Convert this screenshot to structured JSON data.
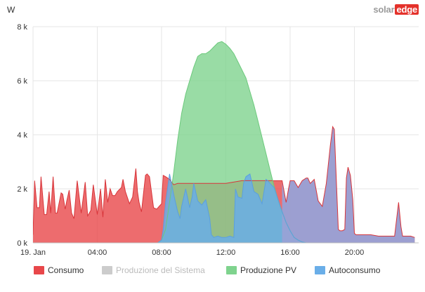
{
  "header": {
    "unit_label": "W",
    "brand_part1": "solar",
    "brand_part2": "edge"
  },
  "colors": {
    "consumo": "#e8474a",
    "produzione_sistema": "#cccccc",
    "produzione_pv": "#7fd38e",
    "autoconsumo": "#6aaee8",
    "overlap": "#98a2d6",
    "grid": "#e6e6e6",
    "axis": "#c0c0c0"
  },
  "chart_data": {
    "type": "area",
    "xlabel": "",
    "ylabel": "W",
    "x_unit": "hours",
    "xlim": [
      0,
      24
    ],
    "ylim": [
      0,
      8000
    ],
    "y_ticks": [
      0,
      2000,
      4000,
      6000,
      8000
    ],
    "y_tick_labels": [
      "0 k",
      "2 k",
      "4 k",
      "6 k",
      "8 k"
    ],
    "x_ticks": [
      0,
      4,
      8,
      12,
      16,
      20
    ],
    "x_tick_labels": [
      "19. Jan",
      "04:00",
      "08:00",
      "12:00",
      "16:00",
      "20:00"
    ],
    "grid": true,
    "legend_position": "bottom",
    "series": [
      {
        "name": "Consumo",
        "color": "#e8474a",
        "x": [
          0.0,
          0.1,
          0.25,
          0.4,
          0.5,
          0.7,
          0.85,
          1.0,
          1.1,
          1.25,
          1.4,
          1.5,
          1.75,
          1.85,
          2.0,
          2.1,
          2.25,
          2.4,
          2.55,
          2.75,
          3.0,
          3.25,
          3.4,
          3.6,
          3.75,
          3.9,
          4.0,
          4.2,
          4.35,
          4.5,
          4.65,
          4.8,
          4.95,
          5.1,
          5.25,
          5.5,
          5.6,
          5.75,
          6.0,
          6.2,
          6.4,
          6.5,
          6.6,
          6.75,
          7.0,
          7.1,
          7.25,
          7.5,
          7.7,
          7.85,
          8.0,
          8.1,
          8.25,
          8.5,
          8.75,
          9.0,
          9.25,
          9.5,
          10.0,
          11.0,
          12.0,
          13.0,
          14.0,
          15.0,
          15.5,
          15.75,
          15.9,
          16.0,
          16.1,
          16.25,
          16.5,
          16.75,
          17.0,
          17.1,
          17.25,
          17.5,
          17.75,
          18.0,
          18.25,
          18.5,
          18.65,
          18.75,
          18.85,
          19.0,
          19.1,
          19.25,
          19.4,
          19.5,
          19.6,
          19.75,
          19.9,
          20.0,
          20.1,
          20.25,
          20.4,
          20.5,
          20.75,
          21.0,
          21.5,
          22.0,
          22.5,
          22.75,
          22.9,
          23.0,
          23.1,
          23.25,
          23.5,
          23.75
        ],
        "values": [
          300,
          2300,
          1300,
          1300,
          2450,
          1050,
          1050,
          1900,
          1100,
          2450,
          1100,
          1100,
          1850,
          1800,
          1250,
          1550,
          1950,
          1100,
          900,
          2300,
          1100,
          2250,
          1000,
          1200,
          2150,
          1500,
          1050,
          2000,
          950,
          2350,
          1500,
          2000,
          1750,
          1750,
          1900,
          2050,
          2350,
          1900,
          1450,
          1700,
          2750,
          1900,
          1500,
          1150,
          2500,
          2550,
          2450,
          1300,
          1250,
          1350,
          1450,
          2500,
          2450,
          2350,
          2150,
          2200,
          2200,
          2200,
          2200,
          2200,
          2200,
          2300,
          2300,
          2300,
          2300,
          1500,
          2000,
          2300,
          2300,
          2300,
          2050,
          2300,
          2400,
          2400,
          2200,
          2350,
          1550,
          1350,
          2200,
          3600,
          4300,
          4200,
          2700,
          500,
          450,
          450,
          500,
          2400,
          2800,
          2500,
          1600,
          350,
          300,
          300,
          300,
          300,
          300,
          300,
          250,
          250,
          250,
          1500,
          600,
          250,
          250,
          250,
          250,
          200
        ]
      },
      {
        "name": "Produzione del Sistema",
        "color": "#cccccc",
        "visible": false,
        "x": [],
        "values": []
      },
      {
        "name": "Produzione PV",
        "color": "#7fd38e",
        "x": [
          7.75,
          8.0,
          8.25,
          8.5,
          8.75,
          9.0,
          9.25,
          9.5,
          9.75,
          10.0,
          10.25,
          10.5,
          10.75,
          11.0,
          11.25,
          11.5,
          11.75,
          12.0,
          12.25,
          12.5,
          12.75,
          13.0,
          13.25,
          13.5,
          13.75,
          14.0,
          14.25,
          14.5,
          14.75,
          15.0,
          15.25,
          15.5,
          15.75,
          16.0,
          16.25,
          16.5,
          16.75,
          17.0,
          17.25
        ],
        "values": [
          0,
          100,
          500,
          1500,
          2600,
          3800,
          4800,
          5500,
          6000,
          6500,
          6900,
          7000,
          7000,
          7100,
          7250,
          7400,
          7450,
          7350,
          7200,
          7000,
          6700,
          6400,
          6100,
          5600,
          5100,
          4500,
          3900,
          3300,
          2700,
          2100,
          1600,
          1150,
          750,
          450,
          200,
          100,
          30,
          0,
          0
        ]
      },
      {
        "name": "Autoconsumo",
        "color": "#6aaee8",
        "x": [
          7.75,
          8.0,
          8.1,
          8.25,
          8.5,
          8.75,
          9.0,
          9.15,
          9.25,
          9.5,
          9.75,
          9.9,
          10.0,
          10.25,
          10.5,
          10.75,
          11.0,
          11.1,
          11.25,
          11.5,
          11.75,
          12.0,
          12.25,
          12.5,
          12.6,
          12.75,
          13.0,
          13.1,
          13.25,
          13.5,
          13.75,
          14.0,
          14.25,
          14.5,
          14.6,
          14.75,
          15.0,
          15.25,
          15.5,
          15.75,
          16.0,
          16.25,
          16.5,
          16.75,
          17.0,
          17.25
        ],
        "values": [
          0,
          100,
          500,
          1500,
          2550,
          1800,
          1150,
          900,
          1350,
          2000,
          1300,
          1700,
          2200,
          1550,
          1400,
          1600,
          900,
          300,
          200,
          250,
          200,
          200,
          250,
          200,
          2000,
          1700,
          1650,
          2200,
          2450,
          2550,
          1900,
          1800,
          1450,
          2350,
          2300,
          2200,
          2050,
          1600,
          1150,
          750,
          450,
          200,
          100,
          30,
          0,
          0
        ]
      }
    ]
  },
  "legend": [
    {
      "label": "Consumo",
      "color": "#e8474a",
      "enabled": true
    },
    {
      "label": "Produzione del Sistema",
      "color": "#cccccc",
      "enabled": false
    },
    {
      "label": "Produzione PV",
      "color": "#7fd38e",
      "enabled": true
    },
    {
      "label": "Autoconsumo",
      "color": "#6aaee8",
      "enabled": true
    }
  ]
}
